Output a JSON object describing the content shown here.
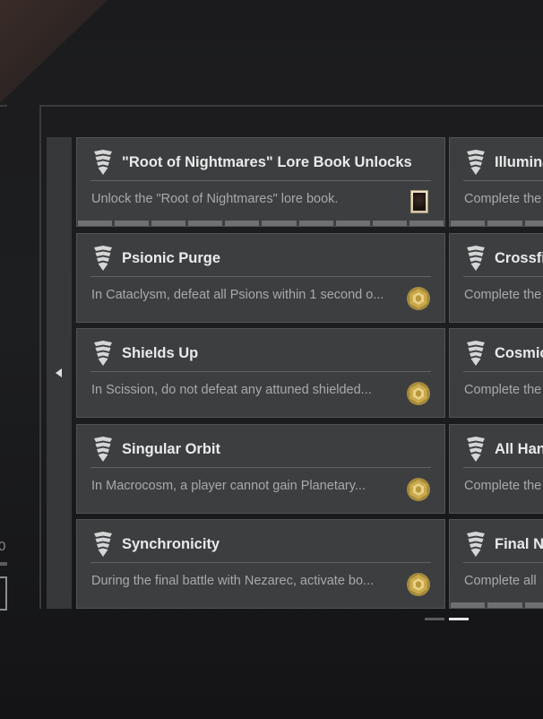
{
  "left_panel": {
    "value_text": "0"
  },
  "triumphs": {
    "column_left": [
      {
        "title": "\"Root of Nightmares\" Lore Book Unlocks",
        "description": "Unlock the \"Root of Nightmares\" lore book.",
        "reward_icon": "lore-book-icon",
        "progress_segments": 10,
        "progress_completed": 0
      },
      {
        "title": "Psionic Purge",
        "description": "In Cataclysm, defeat all Psions within 1 second o...",
        "reward_icon": "bright-dust-icon"
      },
      {
        "title": "Shields Up",
        "description": "In Scission, do not defeat any attuned shielded...",
        "reward_icon": "bright-dust-icon"
      },
      {
        "title": "Singular Orbit",
        "description": "In Macrocosm, a player cannot gain Planetary...",
        "reward_icon": "bright-dust-icon"
      },
      {
        "title": "Synchronicity",
        "description": "During the final battle with Nezarec, activate bo...",
        "reward_icon": "bright-dust-icon"
      }
    ],
    "column_right": [
      {
        "title": "Illumina",
        "description": "Complete the",
        "progress_segments": 3,
        "progress_completed": 0
      },
      {
        "title": "Crossfi",
        "description": "Complete the"
      },
      {
        "title": "Cosmic",
        "description": "Complete the"
      },
      {
        "title": "All Han",
        "description": "Complete the"
      },
      {
        "title": "Final Ni",
        "description": "Complete all",
        "progress_segments": 3,
        "progress_completed": 0
      }
    ]
  },
  "pagination": {
    "pages": 2,
    "current_page": 2
  },
  "colors": {
    "card_background": "#3c3e40",
    "bright_dust_gold": "#c9a94a",
    "text_primary": "#eaeaea",
    "text_secondary": "#a9a9a9"
  }
}
